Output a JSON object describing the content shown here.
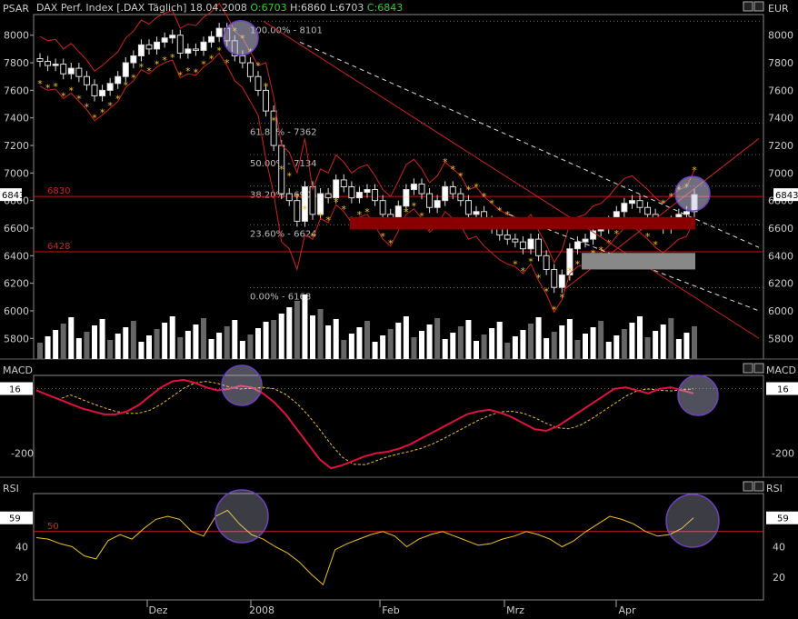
{
  "header": {
    "left_label": "PSAR",
    "right_label": "EUR",
    "title": "DAX Perf. Index [.DAX  Täglich] 18.04.2008",
    "o": "O:6703",
    "h": "H:6860",
    "l": "L:6703",
    "c": "C:6843"
  },
  "price_axis": [
    "8000",
    "7800",
    "7600",
    "7400",
    "7200",
    "7000",
    "6800",
    "6600",
    "6400",
    "6200",
    "6000",
    "5800"
  ],
  "price_tag": "6843",
  "levels": [
    {
      "label": "6830",
      "value": 6830
    },
    {
      "label": "6428",
      "value": 6428
    }
  ],
  "fib_labels": [
    {
      "label": "100.00% - 8101",
      "value": 8101
    },
    {
      "label": "61.80% - 7362",
      "value": 7362
    },
    {
      "label": "50.00% - 7134",
      "value": 7134
    },
    {
      "label": "38.20% - 6906",
      "value": 6906
    },
    {
      "label": "23.60% - 6624",
      "value": 6624
    },
    {
      "label": "0.00% - 6168",
      "value": 6168
    }
  ],
  "macd_panel": {
    "title": "MACD",
    "tag": "16",
    "axis": [
      "-200"
    ]
  },
  "rsi_panel": {
    "title": "RSI",
    "tag": "59",
    "axis": [
      "40",
      "20"
    ],
    "level_label": "50"
  },
  "x_labels": [
    "Dez",
    "2008",
    "Feb",
    "Mrz",
    "Apr"
  ],
  "chart_data": {
    "type": "line",
    "title": "DAX Perf. Index",
    "ylim": [
      5650,
      8150
    ],
    "close": [
      7810,
      7780,
      7790,
      7720,
      7760,
      7700,
      7640,
      7560,
      7600,
      7650,
      7700,
      7800,
      7850,
      7930,
      7900,
      7950,
      7980,
      8000,
      7870,
      7900,
      7890,
      7950,
      7990,
      8050,
      7960,
      7850,
      7800,
      7700,
      7600,
      7450,
      7200,
      6850,
      6800,
      6650,
      6900,
      6700,
      6850,
      6820,
      6950,
      6900,
      6820,
      6860,
      6880,
      6800,
      6700,
      6650,
      6760,
      6880,
      6920,
      6850,
      6750,
      6800,
      6900,
      6850,
      6800,
      6700,
      6720,
      6650,
      6600,
      6550,
      6520,
      6500,
      6450,
      6520,
      6400,
      6300,
      6170,
      6260,
      6450,
      6500,
      6520,
      6580,
      6600,
      6650,
      6720,
      6780,
      6800,
      6750,
      6700,
      6640,
      6600,
      6650,
      6700,
      6720,
      6843
    ],
    "macd": [
      10,
      -5,
      -20,
      -35,
      -50,
      -60,
      -70,
      -70,
      -60,
      -40,
      -10,
      20,
      40,
      45,
      35,
      20,
      10,
      15,
      25,
      20,
      0,
      -30,
      -70,
      -120,
      -170,
      -220,
      -250,
      -240,
      -225,
      -210,
      -200,
      -195,
      -185,
      -170,
      -150,
      -130,
      -110,
      -90,
      -70,
      -60,
      -55,
      -65,
      -80,
      -100,
      -120,
      -125,
      -110,
      -85,
      -60,
      -35,
      -10,
      15,
      20,
      10,
      0,
      15,
      20,
      10,
      0
    ],
    "rsi": [
      46,
      45,
      42,
      40,
      34,
      32,
      44,
      48,
      45,
      52,
      58,
      60,
      58,
      50,
      47,
      60,
      64,
      55,
      48,
      45,
      40,
      36,
      30,
      22,
      15,
      38,
      42,
      45,
      48,
      50,
      47,
      40,
      45,
      48,
      50,
      47,
      44,
      41,
      42,
      45,
      47,
      50,
      48,
      45,
      40,
      44,
      50,
      55,
      60,
      58,
      55,
      50,
      47,
      48,
      52,
      59
    ]
  }
}
